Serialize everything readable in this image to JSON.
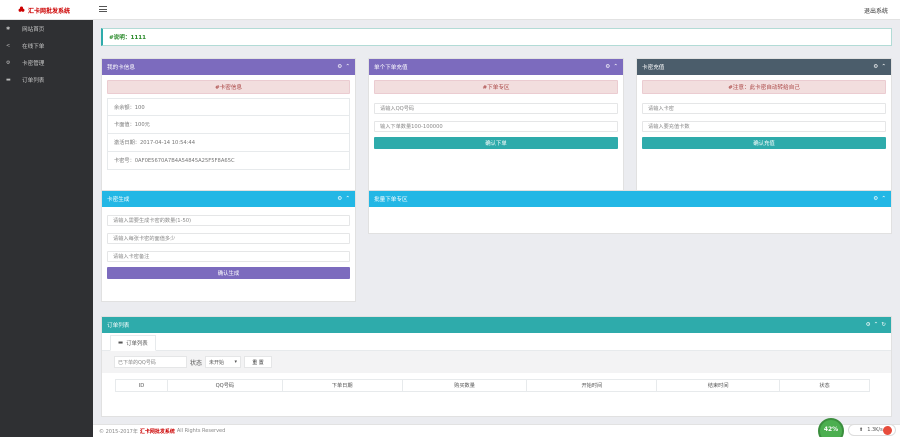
{
  "app": {
    "title": "汇卡网批发系统",
    "logout_label": "退出系统"
  },
  "sidebar": {
    "items": [
      {
        "icon": "home-icon",
        "glyph": "✱",
        "label": "网站首页"
      },
      {
        "icon": "share-icon",
        "glyph": "<",
        "label": "在线下单"
      },
      {
        "icon": "gear-icon",
        "glyph": "⚙",
        "label": "卡密管理"
      },
      {
        "icon": "list-icon",
        "glyph": "▬",
        "label": "订单列表"
      }
    ]
  },
  "notice": {
    "text": "#说明：1111"
  },
  "user_panel": {
    "title": "我的卡信息",
    "alert": "#卡密信息",
    "rows": [
      "余余额：100",
      "卡面值：100元",
      "激活日期：2017-04-14 10:54:44",
      "卡密号：0AF0E5670A7B4A54845A25F5F8A65C"
    ]
  },
  "order_panel": {
    "title": "单个下单充值",
    "alert": "#下单专区",
    "qq_placeholder": "请输入QQ号码",
    "amount_placeholder": "输入下单数量100-100000",
    "button": "确认下单"
  },
  "recharge_panel": {
    "title": "卡密充值",
    "alert": "#注意：此卡密自动转给自己",
    "card_placeholder": "请输入卡密",
    "pwd_placeholder": "请输入要充值卡数",
    "button": "确认充值"
  },
  "generate_panel": {
    "title": "卡密生成",
    "count_placeholder": "请输入需要生成卡密的数量(1-50)",
    "value_placeholder": "请输入每张卡密的面值多少",
    "remark_placeholder": "请输入卡密备注",
    "button": "确认生成"
  },
  "batch_panel": {
    "title": "批量下单专区"
  },
  "orders_panel": {
    "title": "订单列表",
    "tab_label": "订单列表",
    "filter": {
      "qq_placeholder": "已下单的QQ号码",
      "status_label": "状态",
      "status_value": "未开始",
      "reset_button": "重 置"
    },
    "columns": [
      "ID",
      "QQ号码",
      "下单日期",
      "购买数量",
      "开始时间",
      "结束时间",
      "状态"
    ]
  },
  "footer": {
    "copyright": "© 2015-2017年",
    "brand": "汇卡网批发系统",
    "rights": "All Rights Reserved"
  },
  "widget": {
    "percent": "42%",
    "speed": "1.3K/s"
  },
  "colors": {
    "purple": "#7c6bbe",
    "teal": "#2eabab",
    "slate": "#4b5d6b",
    "sky": "#23b7e5",
    "alert_bg": "#f2dede"
  }
}
